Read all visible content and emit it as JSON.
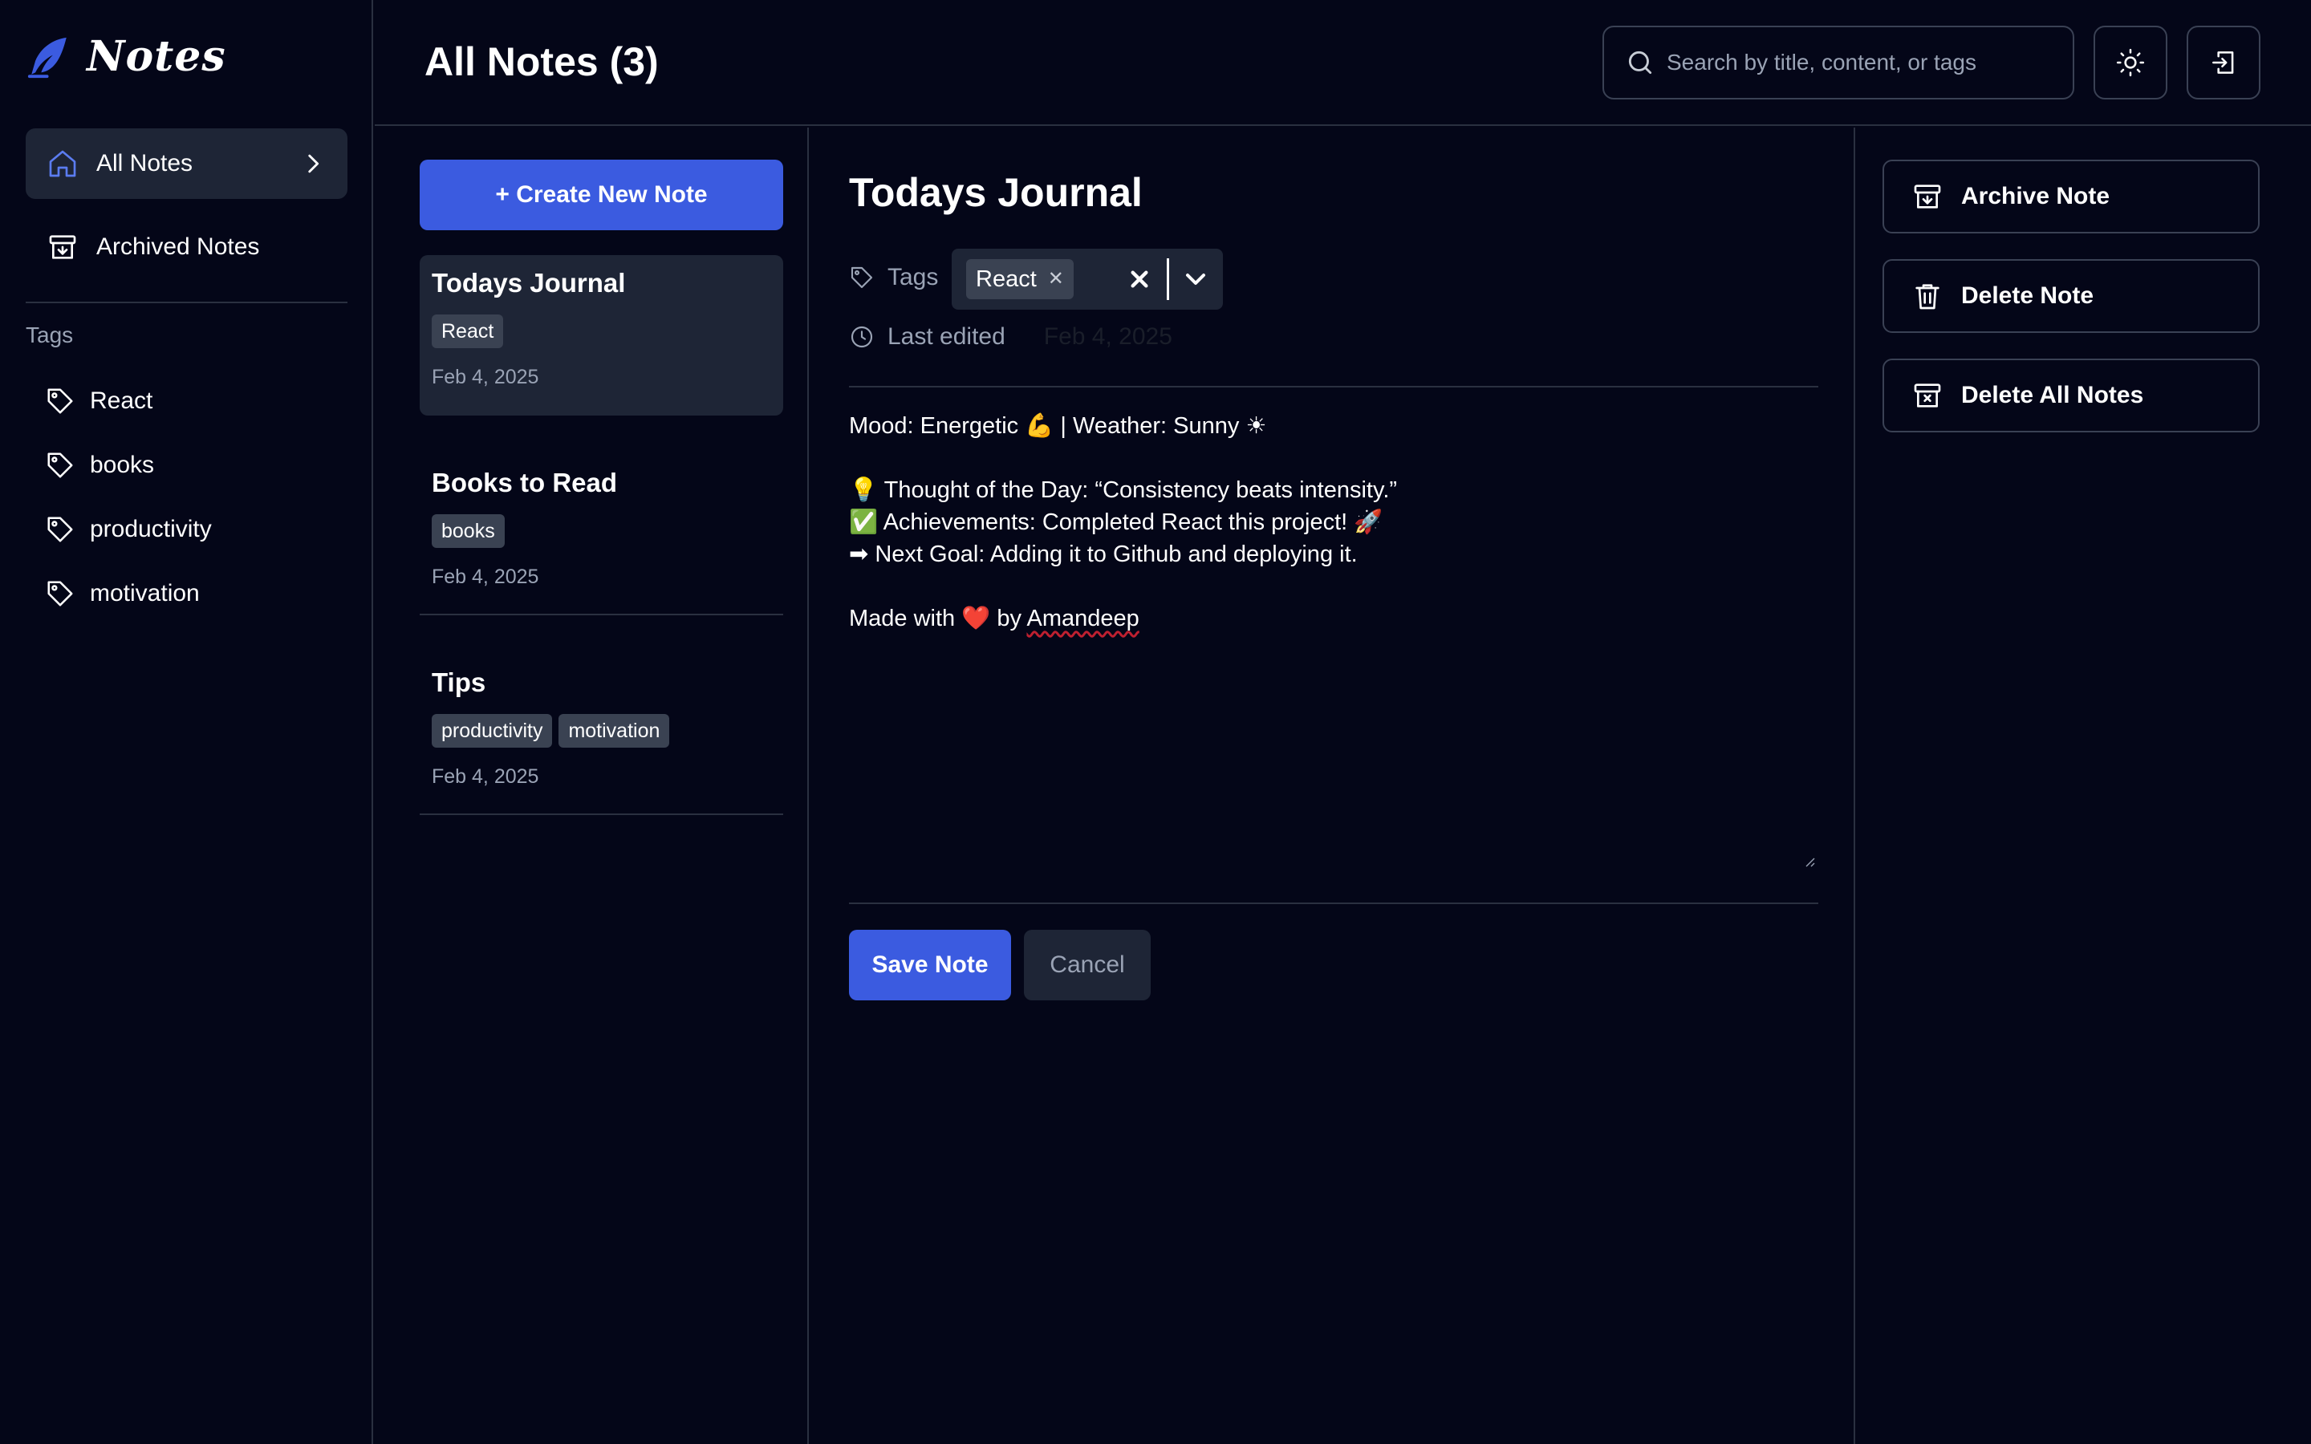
{
  "app": {
    "name": "Notes"
  },
  "sidebar": {
    "nav": [
      {
        "label": "All Notes",
        "icon": "home-icon",
        "active": true
      },
      {
        "label": "Archived Notes",
        "icon": "archive-icon",
        "active": false
      }
    ],
    "tags_heading": "Tags",
    "tags": [
      "React",
      "books",
      "productivity",
      "motivation"
    ]
  },
  "header": {
    "title": "All Notes (3)",
    "search_placeholder": "Search by title, content, or tags",
    "theme_icon": "sun-icon",
    "logout_icon": "logout-icon"
  },
  "notes_list": {
    "create_label": "+ Create New Note",
    "notes": [
      {
        "title": "Todays Journal",
        "tags": [
          "React"
        ],
        "date": "Feb 4, 2025"
      },
      {
        "title": "Books to Read",
        "tags": [
          "books"
        ],
        "date": "Feb 4, 2025"
      },
      {
        "title": "Tips",
        "tags": [
          "productivity",
          "motivation"
        ],
        "date": "Feb 4, 2025"
      }
    ]
  },
  "editor": {
    "title": "Todays Journal",
    "tags_label": "Tags",
    "selected_tag": "React",
    "last_edited_label": "Last edited",
    "last_edited_value": "Feb 4, 2025",
    "body_lines": [
      "Mood: Energetic 💪 | Weather: Sunny ☀",
      "",
      "💡 Thought of the Day: “Consistency beats intensity.”",
      "✅ Achievements: Completed React this project! 🚀",
      "➡ Next Goal: Adding it to Github and deploying it.",
      "",
      "Made with ❤️ by "
    ],
    "body_author": "Amandeep",
    "save_label": "Save Note",
    "cancel_label": "Cancel"
  },
  "actions": {
    "archive_label": "Archive Note",
    "delete_label": "Delete Note",
    "delete_all_label": "Delete All Notes"
  },
  "colors": {
    "background": "#040618",
    "accent": "#3b5be0",
    "surface": "#1e2536",
    "border": "#2a3040",
    "muted_text": "#9aa3b5"
  }
}
